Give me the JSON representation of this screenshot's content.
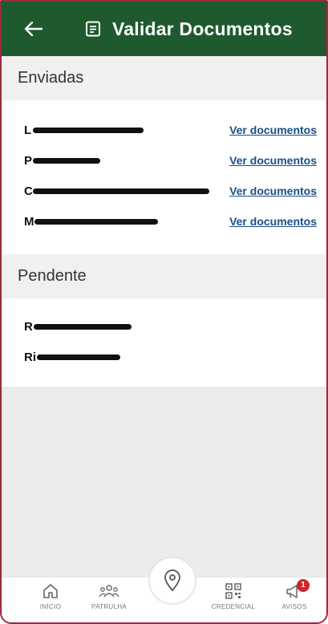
{
  "header": {
    "title": "Validar Documentos",
    "back_icon": "arrow-left-icon",
    "doc_icon": "document-icon"
  },
  "sections": {
    "enviadas": {
      "title": "Enviadas",
      "items": [
        {
          "name": "L",
          "action": "Ver documentos"
        },
        {
          "name": "P",
          "action": "Ver documentos"
        },
        {
          "name": "C",
          "action": "Ver documentos"
        },
        {
          "name": "M",
          "action": "Ver documentos"
        }
      ]
    },
    "pendente": {
      "title": "Pendente",
      "items": [
        {
          "name": "R"
        },
        {
          "name": "Ri"
        }
      ]
    }
  },
  "nav": {
    "items": [
      {
        "label": "INÍCIO",
        "icon": "home-icon"
      },
      {
        "label": "PATRULHA",
        "icon": "group-icon"
      },
      {
        "label": "CREDENCIAL",
        "icon": "qr-code-icon"
      },
      {
        "label": "AVISOS",
        "icon": "megaphone-icon",
        "badge": "1"
      }
    ],
    "center_icon": "location-pin-icon"
  },
  "colors": {
    "header_bg": "#1f5a2f",
    "link": "#1a4f86",
    "badge": "#d32626",
    "frame": "#9c2a3c"
  }
}
